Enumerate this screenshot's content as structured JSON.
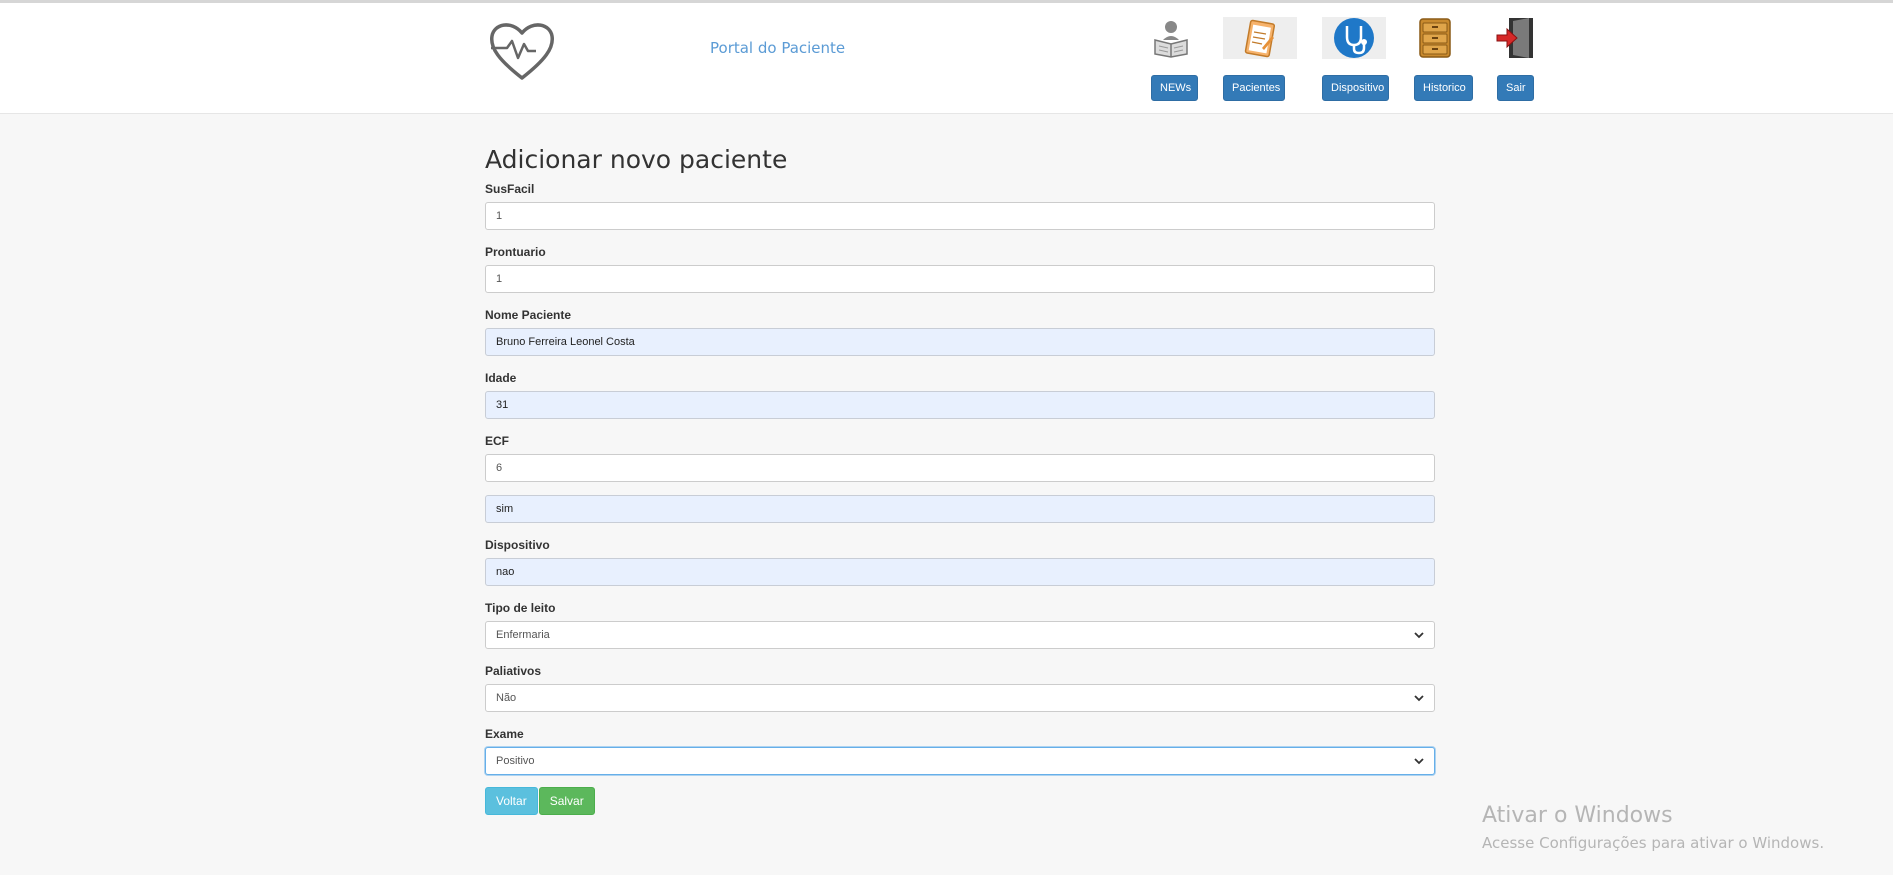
{
  "header": {
    "portal_title": "Portal do Paciente",
    "nav": [
      {
        "label": "NEWs",
        "icon": "reader-icon"
      },
      {
        "label": "Pacientes",
        "icon": "clipboard-icon"
      },
      {
        "label": "Dispositivo",
        "icon": "stethoscope-icon"
      },
      {
        "label": "Historico",
        "icon": "file-cabinet-icon"
      },
      {
        "label": "Sair",
        "icon": "exit-door-icon"
      }
    ]
  },
  "form": {
    "title": "Adicionar novo paciente",
    "susfacil": {
      "label": "SusFacil",
      "value": "1"
    },
    "prontuario": {
      "label": "Prontuario",
      "value": "1"
    },
    "nome": {
      "label": "Nome Paciente",
      "value": "Bruno Ferreira Leonel Costa"
    },
    "idade": {
      "label": "Idade",
      "value": "31"
    },
    "ecf": {
      "label": "ECF",
      "value": "6"
    },
    "unlabeled": {
      "value": "sim"
    },
    "dispositivo": {
      "label": "Dispositivo",
      "value": "nao"
    },
    "tipo_leito": {
      "label": "Tipo de leito",
      "selected": "Enfermaria"
    },
    "paliativos": {
      "label": "Paliativos",
      "selected": "Não"
    },
    "exame": {
      "label": "Exame",
      "selected": "Positivo"
    },
    "back_label": "Voltar",
    "save_label": "Salvar"
  },
  "watermark": {
    "title": "Ativar o Windows",
    "subtitle": "Acesse Configurações para ativar o Windows."
  },
  "colors": {
    "primary": "#337ab7",
    "info": "#5bc0de",
    "success": "#5cb85c",
    "autofill": "#e8f0fe",
    "portal_title": "#5b9bd5"
  }
}
